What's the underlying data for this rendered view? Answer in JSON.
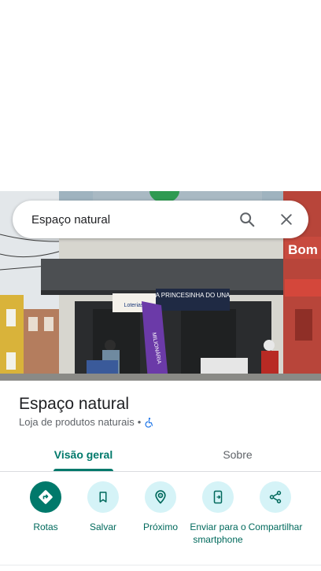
{
  "search": {
    "query": "Espaço natural"
  },
  "photo": {
    "sign_bank": "Bom",
    "sign_store": "A PRINCESINHA DO UNA",
    "sign_lottery": "Loterias",
    "banner": "MILIONÁRIA"
  },
  "place": {
    "name": "Espaço natural",
    "category": "Loja de produtos naturais",
    "separator": "•",
    "accessibility_icon": "wheelchair-icon"
  },
  "tabs": [
    {
      "label": "Visão geral",
      "active": true
    },
    {
      "label": "Sobre",
      "active": false
    }
  ],
  "actions": [
    {
      "label": "Rotas",
      "icon": "directions-icon"
    },
    {
      "label": "Salvar",
      "icon": "bookmark-icon"
    },
    {
      "label": "Próximo",
      "icon": "nearby-icon"
    },
    {
      "label": "Enviar para o smartphone",
      "icon": "send-to-phone-icon"
    },
    {
      "label": "Compartilhar",
      "icon": "share-icon"
    }
  ],
  "colors": {
    "accent": "#00796b",
    "action_bg": "#d5f3f7",
    "accessibility": "#1a73e8"
  }
}
